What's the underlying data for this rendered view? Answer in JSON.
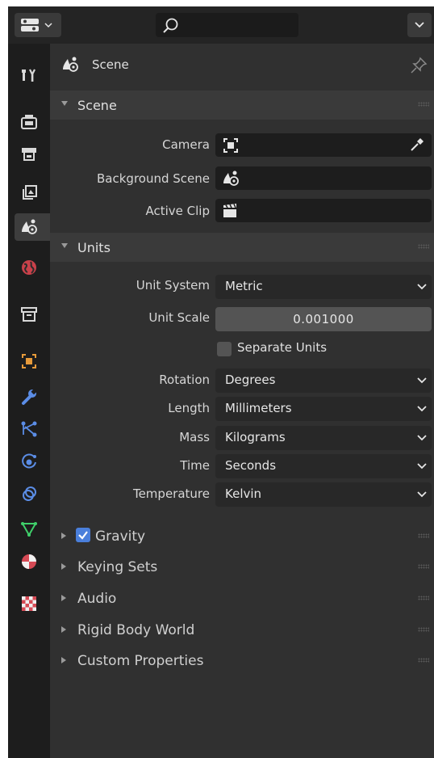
{
  "panel": {
    "context": "Scene"
  },
  "scene_section": {
    "title": "Scene",
    "rows": {
      "camera": "Camera",
      "background_scene": "Background Scene",
      "active_clip": "Active Clip"
    }
  },
  "units_section": {
    "title": "Units",
    "unit_system": {
      "label": "Unit System",
      "value": "Metric"
    },
    "unit_scale": {
      "label": "Unit Scale",
      "value": "0.001000"
    },
    "separate_units": {
      "label": "Separate Units",
      "checked": false
    },
    "rotation": {
      "label": "Rotation",
      "value": "Degrees"
    },
    "length": {
      "label": "Length",
      "value": "Millimeters"
    },
    "mass": {
      "label": "Mass",
      "value": "Kilograms"
    },
    "time": {
      "label": "Time",
      "value": "Seconds"
    },
    "temperature": {
      "label": "Temperature",
      "value": "Kelvin"
    }
  },
  "collapsed_sections": {
    "gravity": {
      "label": "Gravity",
      "checked": true
    },
    "keying_sets": "Keying Sets",
    "audio": "Audio",
    "rigid_body_world": "Rigid Body World",
    "custom_properties": "Custom Properties"
  },
  "colors": {
    "accent": "#4a7fdb",
    "panel_bg": "#303030",
    "field_bg": "#1d1d1d"
  }
}
